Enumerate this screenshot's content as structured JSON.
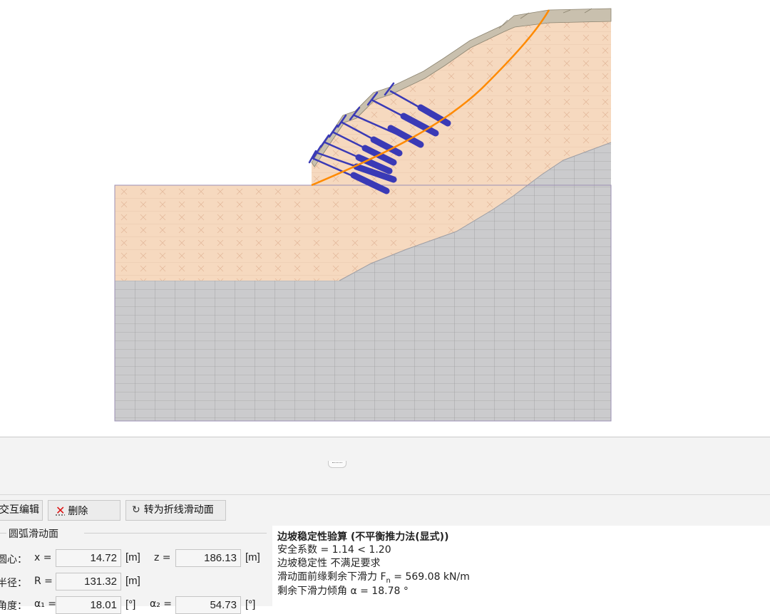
{
  "toolbar": {
    "interactive_edit_label": "交互编辑",
    "delete_label": "删除",
    "delete_icon": "x-icon",
    "convert_label": "转为折线滑动面",
    "convert_icon": "rotate-icon"
  },
  "slip_surface": {
    "group_title": "圆弧滑动面",
    "center_label": "圆心：",
    "x_label": "x =",
    "x_value": "14.72",
    "x_unit": "[m]",
    "z_label": "z =",
    "z_value": "186.13",
    "z_unit": "[m]",
    "radius_label": "半径：",
    "r_label": "R =",
    "r_value": "131.32",
    "r_unit": "[m]",
    "angle_label": "角度：",
    "a1_label": "α₁ =",
    "a1_value": "18.01",
    "a1_unit": "[°]",
    "a2_label": "α₂ =",
    "a2_value": "54.73",
    "a2_unit": "[°]"
  },
  "results": {
    "title": "边坡稳定性验算 (不平衡推力法(显式))",
    "safety_factor": "安全系数 = 1.14 < 1.20",
    "status": "边坡稳定性 不满足要求",
    "force_prefix": "滑动面前缘剩余下滑力 F",
    "force_sub": "n",
    "force_suffix": " = 569.08 kN/m",
    "angle": "剩余下滑力倾角 α = 18.78 °"
  },
  "colors": {
    "soil": "#f6d9bf",
    "rock": "#cbcbcd",
    "topsoil": "#c9c0ae",
    "slip_circle": "#ff8a00",
    "anchors": "#3a3ab6",
    "fail": "#e01010"
  }
}
